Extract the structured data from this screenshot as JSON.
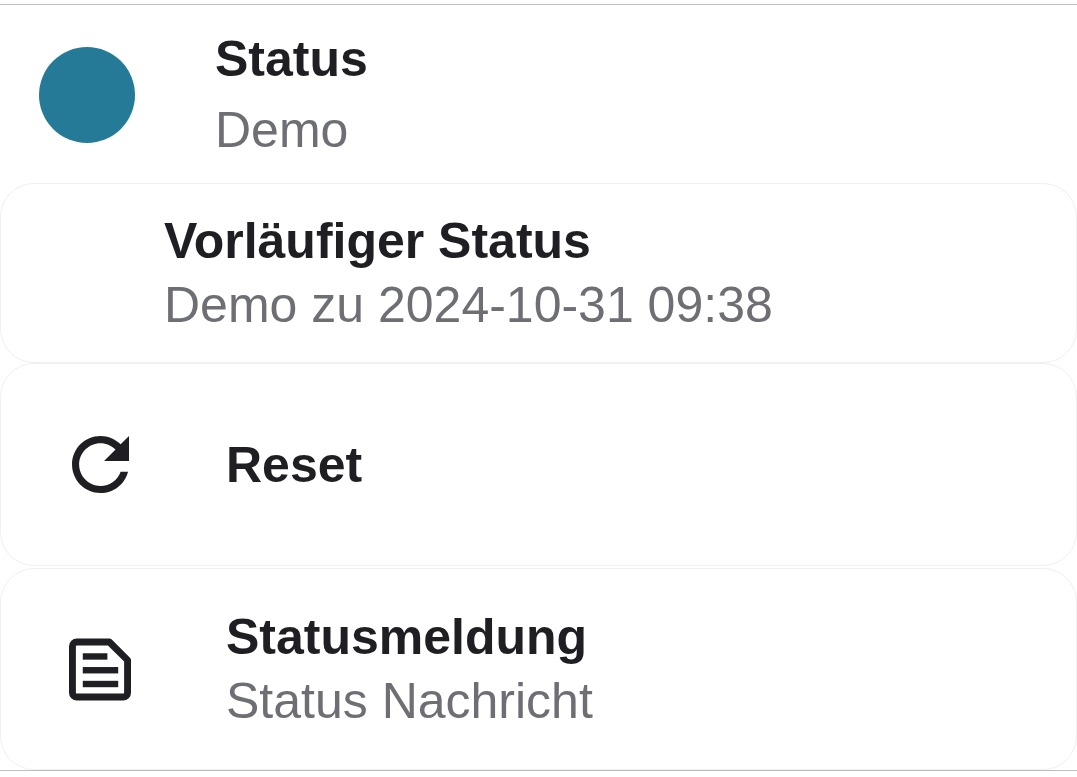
{
  "header": {
    "title": "Status",
    "subtitle": "Demo"
  },
  "items": [
    {
      "kind": "plain",
      "title": "Vorläufiger Status",
      "subtitle": "Demo zu 2024-10-31 09:38"
    },
    {
      "kind": "reset",
      "title": "Reset"
    },
    {
      "kind": "message",
      "title": "Statusmeldung",
      "subtitle": "Status Nachricht"
    }
  ]
}
